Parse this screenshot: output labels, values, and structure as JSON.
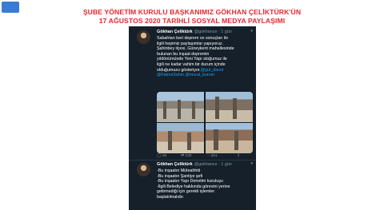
{
  "header": {
    "line1": "ŞUBE YÖNETİM KURULU BAŞKANIMIZ GÖKHAN ÇELİKTÜRK'ÜN",
    "line2": "17 AĞUSTOS 2020 TARİHLİ SOSYAL MEDYA PAYLAŞIMI",
    "color": "#e8262d"
  },
  "tweets": [
    {
      "name": "Gökhan Çeliktürk",
      "handle": "@gokhance · 1 gün",
      "lines": [
        "Sabahtan beri deprem ve sonuçları ile",
        "ilgili hepimiz paylaşımlar yapıyoruz.",
        "Şahinbey ilçesi, Güneykent mahallesinde",
        "bulunan bu inşaat depremin",
        "yıldönümünde Yeni Yapı stoğumuz ile",
        "ilgili ne kadar vahim bir durum içinde",
        "olduğumuzu gösteriyor."
      ],
      "mentions_1": "@gul_davut",
      "mentions_2": "@FatmaSahin @murat_kurum",
      "stats": {
        "replies": "28",
        "retweets": "100",
        "likes": "251"
      }
    },
    {
      "name": "Gökhan Çeliktürk",
      "handle": "@gokhance · 1 gün",
      "lines": [
        "-Bu inşaatın Müteahhiti",
        "-Bu inşaatın Şantiye şefi",
        "-Bu inşaatın Yapı Denetim kuruluşu",
        "-İlgili Belediye hakkında görevini yerine",
        "getirmediği için gerekli işlemler",
        "başlatılmalıdır."
      ]
    }
  ],
  "icons": [
    "reply-icon",
    "retweet-icon",
    "like-icon",
    "share-icon",
    "caret-down-icon"
  ],
  "colors": {
    "background": "#15202b",
    "link": "#1da1f2",
    "muted": "#8899a6"
  }
}
